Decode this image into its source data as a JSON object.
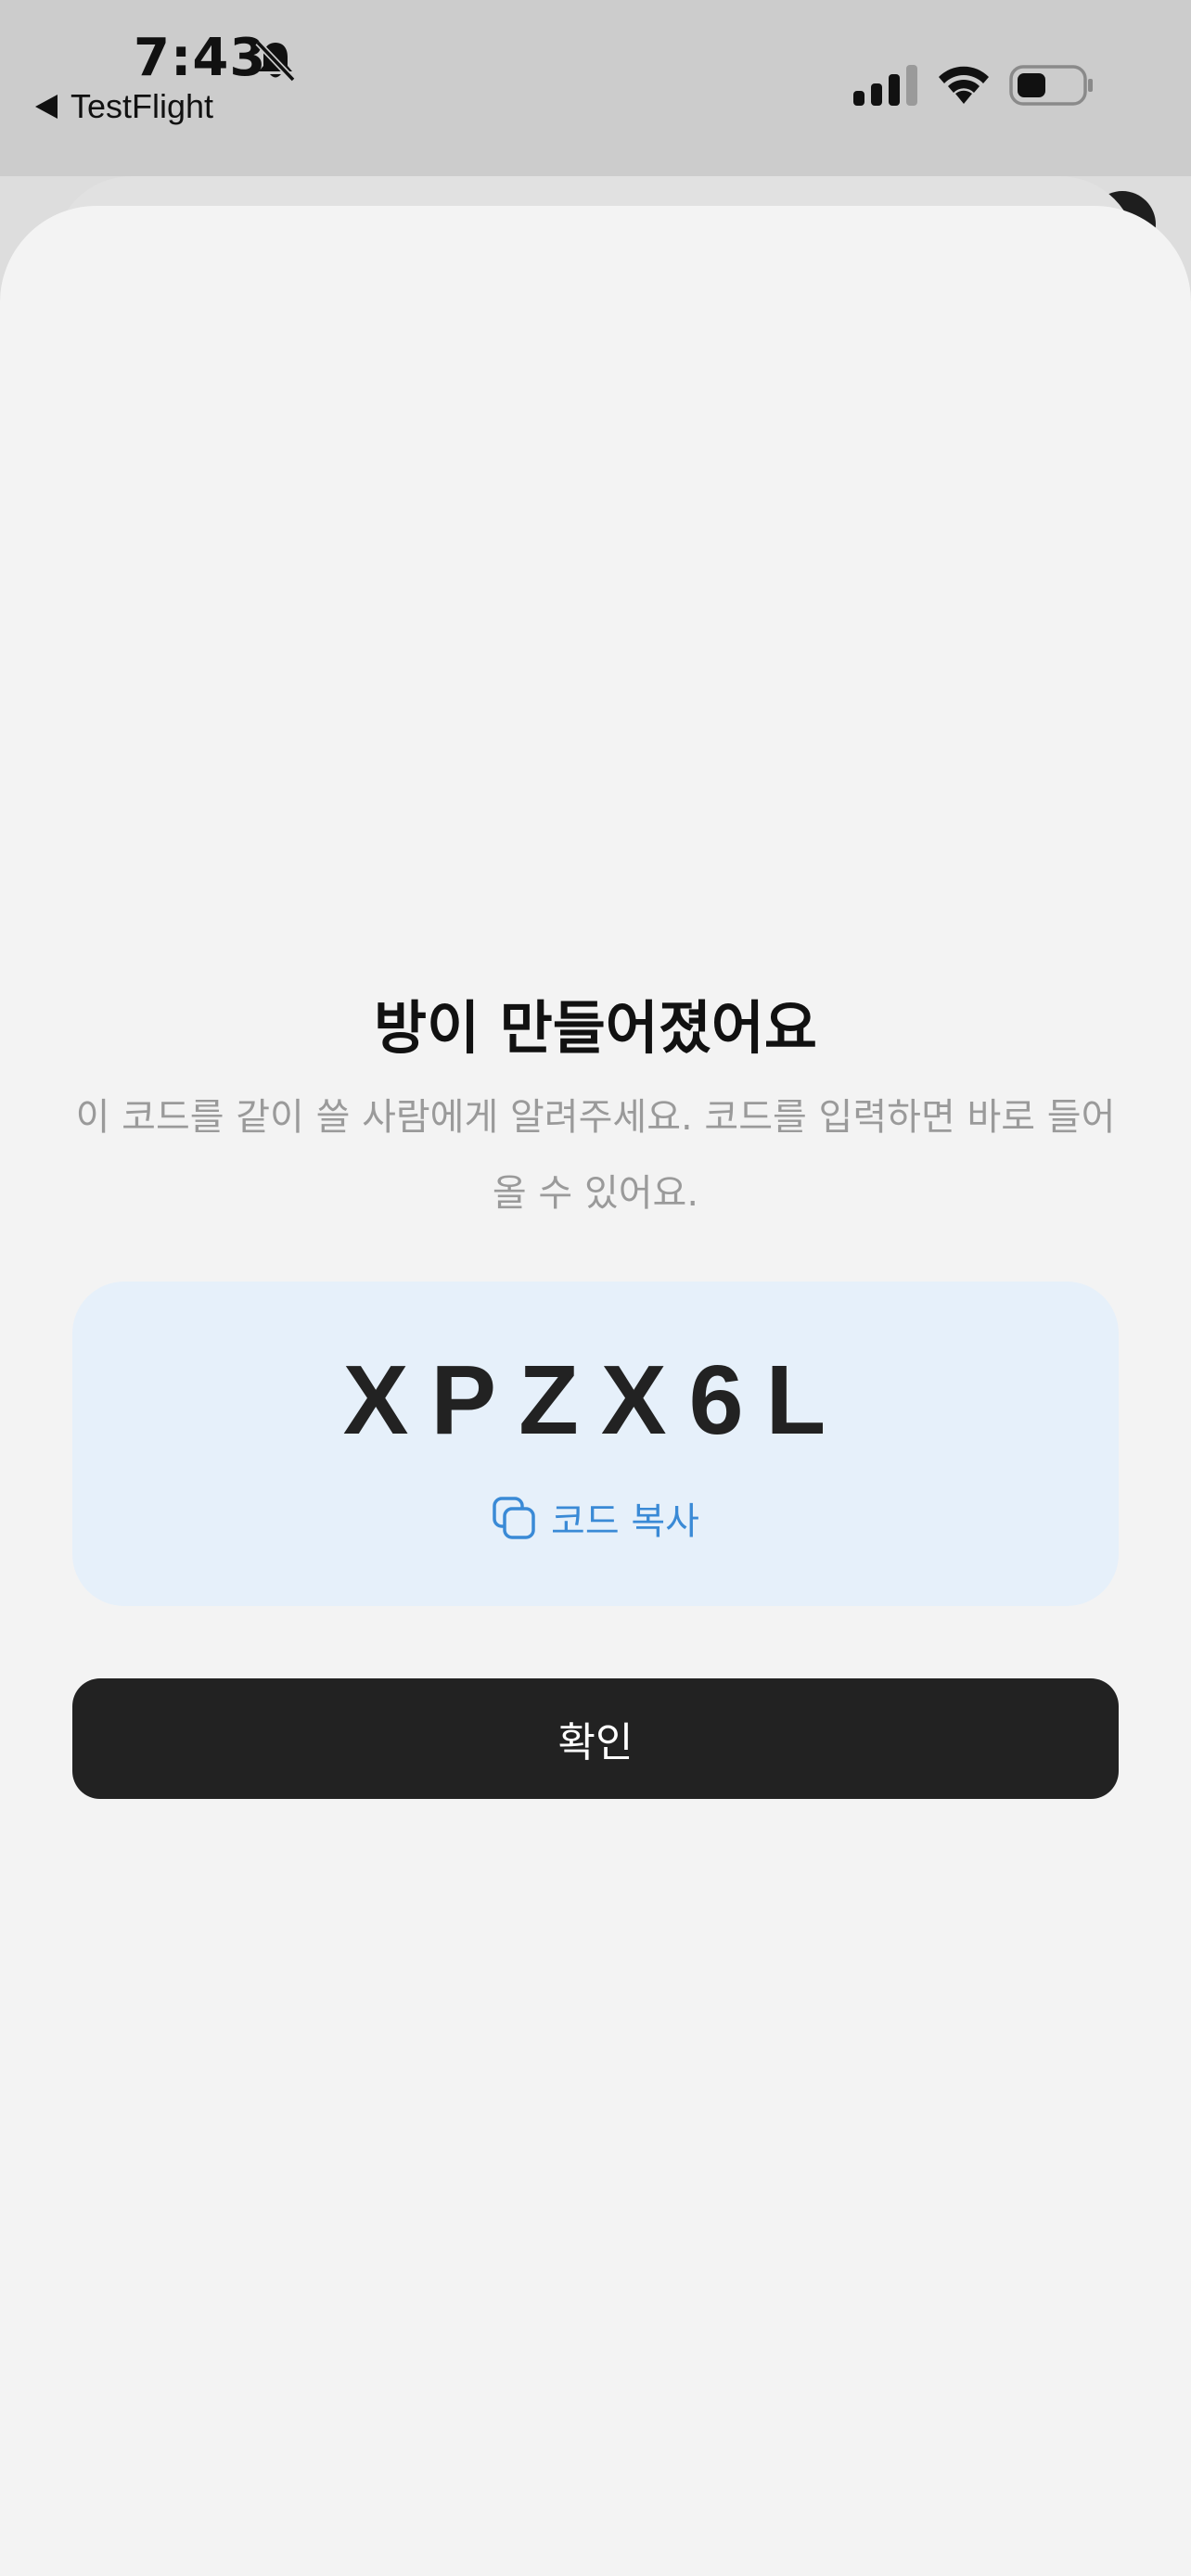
{
  "status_bar": {
    "time": "7:43",
    "back_app": "TestFlight",
    "icons": [
      "bell-slash-icon",
      "signal-icon",
      "wifi-icon",
      "battery-icon"
    ]
  },
  "sheet": {
    "title": "방이 만들어졌어요",
    "subtitle": "이 코드를 같이 쓸 사람에게 알려주세요. 코드를 입력하면 바로 들어올 수 있어요.",
    "code": "XPZX6L",
    "copy_label": "코드 복사",
    "confirm_label": "확인"
  },
  "colors": {
    "code_card_bg": "#e6f0fa",
    "accent": "#3a8ad6",
    "confirm_bg": "#222222",
    "sheet_bg": "#f3f3f3"
  }
}
